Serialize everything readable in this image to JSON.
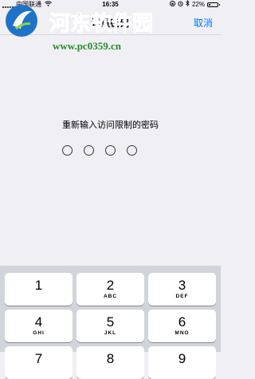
{
  "status_bar": {
    "carrier": "中国联通",
    "time": "16:35",
    "battery_text": "22%",
    "battery_level": 0.22
  },
  "nav": {
    "title": "设置密码",
    "cancel_label": "取消"
  },
  "watermark": {
    "name": "河东软件园",
    "url": "www.pc0359.cn"
  },
  "passcode": {
    "prompt": "重新输入访问限制的密码",
    "digits_total": 4,
    "digits_entered": 0
  },
  "keypad": {
    "keys": [
      {
        "digit": "1",
        "letters": ""
      },
      {
        "digit": "2",
        "letters": "ABC"
      },
      {
        "digit": "3",
        "letters": "DEF"
      },
      {
        "digit": "4",
        "letters": "GHI"
      },
      {
        "digit": "5",
        "letters": "JKL"
      },
      {
        "digit": "6",
        "letters": "MNO"
      },
      {
        "digit": "7",
        "letters": ""
      },
      {
        "digit": "8",
        "letters": ""
      },
      {
        "digit": "9",
        "letters": ""
      }
    ]
  },
  "colors": {
    "accent": "#007aff",
    "background": "#efeff4",
    "keypad_background": "#d1d4db",
    "watermark_blue": "#1e73c8",
    "watermark_green": "#2a8a2a"
  }
}
